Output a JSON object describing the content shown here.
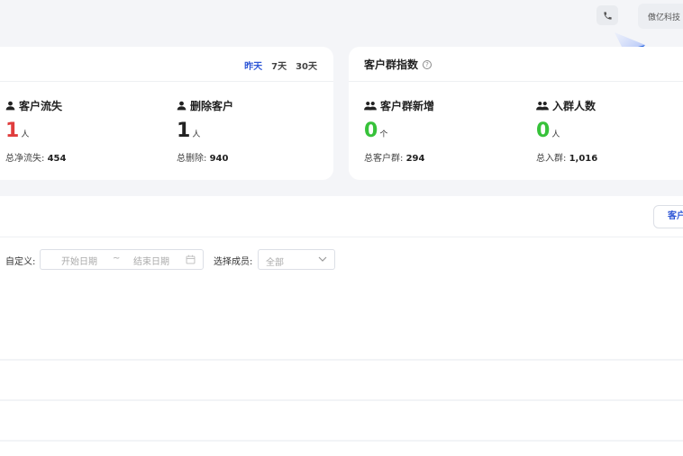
{
  "topbar": {
    "phone_icon": "phone-icon",
    "company_name": "傲亿科技"
  },
  "customer_card": {
    "range_tabs": [
      "昨天",
      "7天",
      "30天"
    ],
    "active_range": "昨天",
    "metrics": [
      {
        "label": "客户流失",
        "icon": "user-icon",
        "value": "1",
        "unit": "人",
        "total_label": "总净流失:",
        "total_value": "454",
        "color": "#e03d3d"
      },
      {
        "label": "删除客户",
        "icon": "user-icon",
        "value": "1",
        "unit": "人",
        "total_label": "总删除:",
        "total_value": "940",
        "color": "#222222"
      }
    ]
  },
  "group_card": {
    "title": "客户群指数",
    "help_icon": "question-circle-icon",
    "metrics": [
      {
        "label": "客户群新增",
        "icon": "users-icon",
        "value": "0",
        "unit": "个",
        "total_label": "总客户群:",
        "total_value": "294",
        "color": "#37c23a"
      },
      {
        "label": "入群人数",
        "icon": "users-icon",
        "value": "0",
        "unit": "人",
        "total_label": "总入群:",
        "total_value": "1,016",
        "color": "#37c23a"
      }
    ]
  },
  "panel": {
    "tab_button": "客户",
    "custom_label": "自定义:",
    "start_placeholder": "开始日期",
    "range_separator": "~",
    "end_placeholder": "结束日期",
    "calendar_icon": "calendar-icon",
    "member_label": "选择成员:",
    "member_value": "全部",
    "chevron_icon": "chevron-down-icon"
  },
  "chart_data": {
    "type": "area",
    "title": "",
    "series": [
      {
        "values": [
          0,
          0,
          0,
          0,
          0,
          0,
          0,
          0
        ]
      }
    ],
    "line_color": "#4a66d6",
    "fill_color": "#e9ecfb",
    "grid": true
  }
}
